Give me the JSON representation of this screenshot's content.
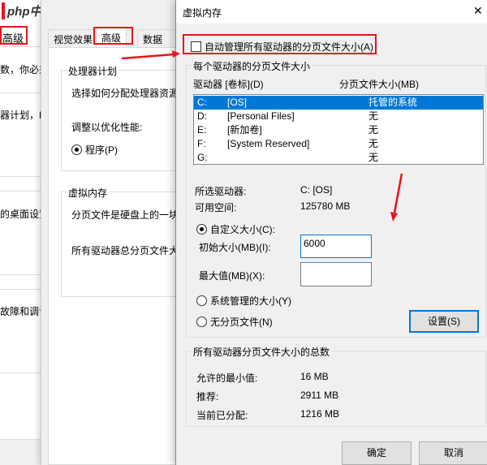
{
  "watermark": "php中文网",
  "back_window": {
    "title_suffix": "选项",
    "tab": "高级",
    "texts": [
      "数，你必须",
      "器计划，P",
      "的桌面设置",
      "故障和调试"
    ]
  },
  "perf_window": {
    "tabs": [
      "视觉效果",
      "高级",
      "数据执行"
    ],
    "processor_group": {
      "title": "处理器计划",
      "desc": "选择如何分配处理器资源",
      "adjust": "调整以优化性能:",
      "radio": "程序(P)"
    },
    "vm_group": {
      "title": "虚拟内存",
      "desc": "分页文件是硬盘上的一块",
      "total": "所有驱动器总分页文件大"
    }
  },
  "dialog": {
    "title": "虚拟内存",
    "close": "✕",
    "auto_manage": "自动管理所有驱动器的分页文件大小(A)",
    "per_drive_group": "每个驱动器的分页文件大小",
    "col_drive": "驱动器 [卷标](D)",
    "col_size": "分页文件大小(MB)",
    "drives": [
      {
        "drive": "C:",
        "label": "[OS]",
        "size": "托管的系统"
      },
      {
        "drive": "D:",
        "label": "[Personal Files]",
        "size": "无"
      },
      {
        "drive": "E:",
        "label": "[新加卷]",
        "size": "无"
      },
      {
        "drive": "F:",
        "label": "[System Reserved]",
        "size": "无"
      },
      {
        "drive": "G:",
        "label": "",
        "size": "无"
      }
    ],
    "selected_drive_label": "所选驱动器:",
    "selected_drive_value": "C:  [OS]",
    "free_space_label": "可用空间:",
    "free_space_value": "125780 MB",
    "custom_size": "自定义大小(C):",
    "initial_label": "初始大小(MB)(I):",
    "initial_value": "6000",
    "max_label": "最大值(MB)(X):",
    "max_value": "",
    "system_managed": "系统管理的大小(Y)",
    "no_paging": "无分页文件(N)",
    "set_button": "设置(S)",
    "totals_group": "所有驱动器分页文件大小的总数",
    "min_label": "允许的最小值:",
    "min_value": "16 MB",
    "rec_label": "推荐:",
    "rec_value": "2911 MB",
    "cur_label": "当前已分配:",
    "cur_value": "1216 MB",
    "ok": "确定",
    "cancel": "取消"
  },
  "colors": {
    "accent": "#0078d7",
    "annotation": "#e8131b"
  }
}
